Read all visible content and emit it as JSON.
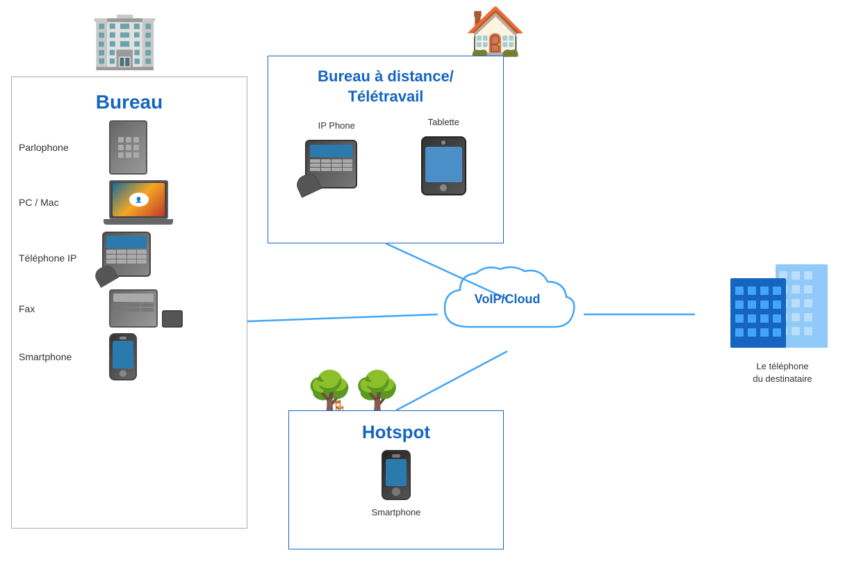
{
  "bureau": {
    "title": "Bureau",
    "items": [
      {
        "label": "Parlophone",
        "icon": "🔲"
      },
      {
        "label": "PC / Mac",
        "icon": "💻"
      },
      {
        "label": "Téléphone IP",
        "icon": "☎"
      },
      {
        "label": "Fax",
        "icon": "📠"
      },
      {
        "label": "Smartphone",
        "icon": "📱"
      }
    ]
  },
  "remote": {
    "title": "Bureau à distance/\nTélétravail",
    "items": [
      {
        "label": "IP Phone",
        "icon": "☎"
      },
      {
        "label": "Tablette",
        "icon": "📱"
      }
    ]
  },
  "hotspot": {
    "title": "Hotspot",
    "items": [
      {
        "label": "Smartphone",
        "icon": "📱"
      }
    ]
  },
  "voip": {
    "label": "VoIP/Cloud"
  },
  "destination": {
    "label": "Le téléphone\ndu destinataire"
  },
  "colors": {
    "blue": "#1565c0",
    "line": "#42a5f5",
    "border": "#aaa"
  }
}
